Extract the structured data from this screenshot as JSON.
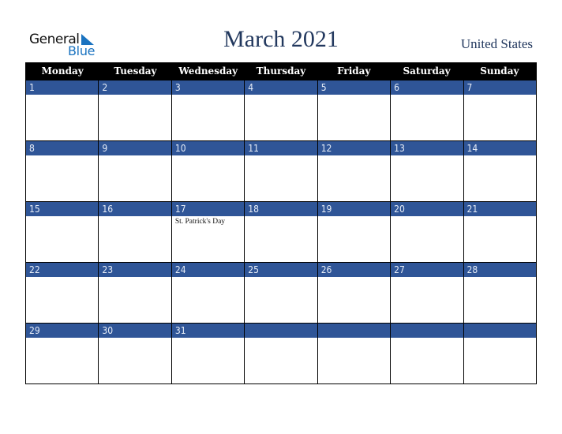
{
  "logo": {
    "word1": "General",
    "word2": "Blue",
    "icon": "triangle-flag-icon",
    "accent": "#1a73c0"
  },
  "header": {
    "title": "March 2021",
    "country": "United States",
    "title_color": "#22385e"
  },
  "calendar": {
    "band_color": "#2f5597",
    "weekdays": [
      "Monday",
      "Tuesday",
      "Wednesday",
      "Thursday",
      "Friday",
      "Saturday",
      "Sunday"
    ],
    "weeks": [
      [
        {
          "day": "1",
          "event": ""
        },
        {
          "day": "2",
          "event": ""
        },
        {
          "day": "3",
          "event": ""
        },
        {
          "day": "4",
          "event": ""
        },
        {
          "day": "5",
          "event": ""
        },
        {
          "day": "6",
          "event": ""
        },
        {
          "day": "7",
          "event": ""
        }
      ],
      [
        {
          "day": "8",
          "event": ""
        },
        {
          "day": "9",
          "event": ""
        },
        {
          "day": "10",
          "event": ""
        },
        {
          "day": "11",
          "event": ""
        },
        {
          "day": "12",
          "event": ""
        },
        {
          "day": "13",
          "event": ""
        },
        {
          "day": "14",
          "event": ""
        }
      ],
      [
        {
          "day": "15",
          "event": ""
        },
        {
          "day": "16",
          "event": ""
        },
        {
          "day": "17",
          "event": "St. Patrick's Day"
        },
        {
          "day": "18",
          "event": ""
        },
        {
          "day": "19",
          "event": ""
        },
        {
          "day": "20",
          "event": ""
        },
        {
          "day": "21",
          "event": ""
        }
      ],
      [
        {
          "day": "22",
          "event": ""
        },
        {
          "day": "23",
          "event": ""
        },
        {
          "day": "24",
          "event": ""
        },
        {
          "day": "25",
          "event": ""
        },
        {
          "day": "26",
          "event": ""
        },
        {
          "day": "27",
          "event": ""
        },
        {
          "day": "28",
          "event": ""
        }
      ],
      [
        {
          "day": "29",
          "event": ""
        },
        {
          "day": "30",
          "event": ""
        },
        {
          "day": "31",
          "event": ""
        },
        {
          "day": "",
          "event": ""
        },
        {
          "day": "",
          "event": ""
        },
        {
          "day": "",
          "event": ""
        },
        {
          "day": "",
          "event": ""
        }
      ]
    ]
  }
}
